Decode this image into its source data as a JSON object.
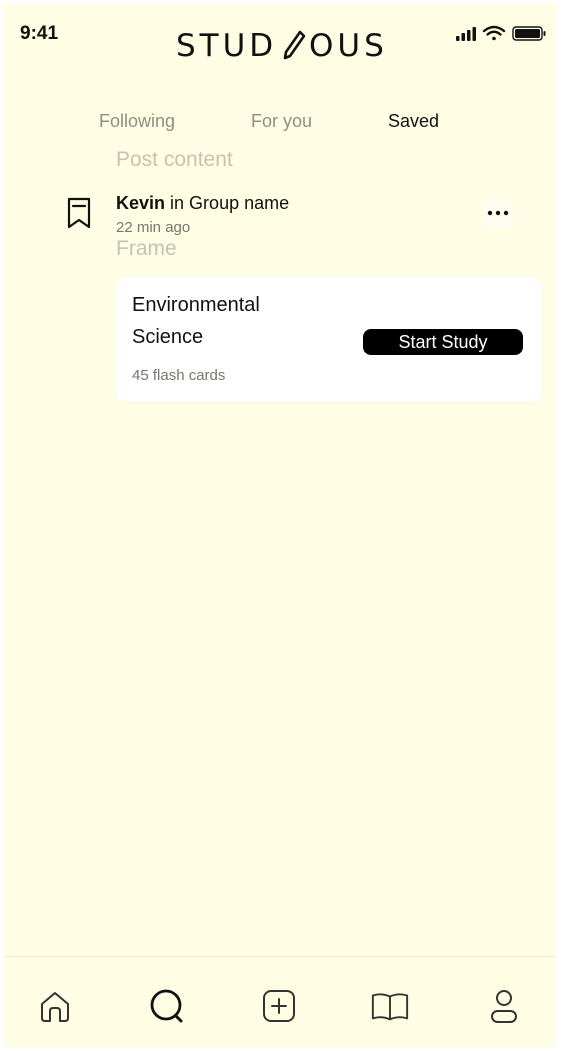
{
  "status_bar": {
    "time": "9:41"
  },
  "app": {
    "logo_text": "STUDIOUS"
  },
  "tabs": [
    {
      "label": "Following",
      "active": false
    },
    {
      "label": "For you",
      "active": false
    },
    {
      "label": "Saved",
      "active": true
    }
  ],
  "labels": {
    "post_content": "Post content",
    "frame": "Frame"
  },
  "post": {
    "author": "Kevin",
    "group_text": "in Group name",
    "time_ago": "22 min ago"
  },
  "card": {
    "title": "Environmental Science",
    "count": "45 flash cards",
    "button_label": "Start Study"
  },
  "bottom_nav": [
    {
      "icon": "home-icon"
    },
    {
      "icon": "search-icon",
      "active": true
    },
    {
      "icon": "add-square-icon"
    },
    {
      "icon": "book-icon"
    },
    {
      "icon": "profile-icon"
    }
  ],
  "colors": {
    "background": "#fffee4",
    "card": "#ffffff",
    "accent": "#000000",
    "muted_text": "#8e8e84"
  }
}
